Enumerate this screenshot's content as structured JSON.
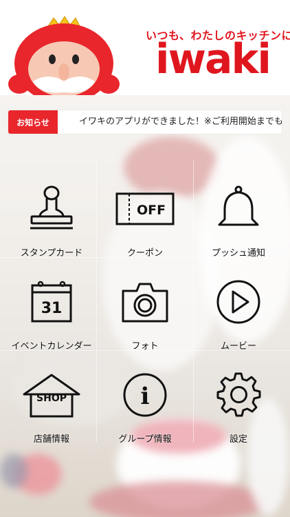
{
  "header": {
    "tagline": "いつも、わたしのキッチンに",
    "logo": "iwaki",
    "brand_color": "#e0161e"
  },
  "notice": {
    "badge": "お知らせ",
    "text": "イワキのアプリができました！※ご利用開始までも",
    "badge_color": "#e8262c"
  },
  "menu": [
    {
      "label": "スタンプカード",
      "icon": "stamp-icon"
    },
    {
      "label": "クーポン",
      "icon": "coupon-icon",
      "icon_text": "OFF"
    },
    {
      "label": "プッシュ通知",
      "icon": "bell-icon"
    },
    {
      "label": "イベントカレンダー",
      "icon": "calendar-icon",
      "icon_text": "31"
    },
    {
      "label": "フォト",
      "icon": "camera-icon"
    },
    {
      "label": "ムービー",
      "icon": "play-icon"
    },
    {
      "label": "店舗情報",
      "icon": "shop-icon",
      "icon_text": "SHOP"
    },
    {
      "label": "グループ情報",
      "icon": "info-icon",
      "icon_text": "i"
    },
    {
      "label": "設定",
      "icon": "gear-icon"
    }
  ]
}
